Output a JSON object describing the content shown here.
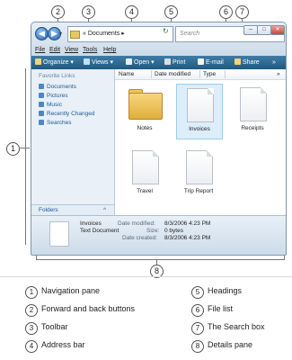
{
  "callouts": [
    "1",
    "2",
    "3",
    "4",
    "5",
    "6",
    "7",
    "8"
  ],
  "address_bar": {
    "prefix": "«",
    "path": "Documents",
    "separator": "▸",
    "dropdown": "▾",
    "refresh": "↻"
  },
  "search": {
    "placeholder": "Search"
  },
  "window_controls": {
    "minimize": "─",
    "maximize": "□",
    "close": "✕"
  },
  "nav_buttons": {
    "back": "◀",
    "forward": "▶",
    "history": "▾"
  },
  "menu": [
    "File",
    "Edit",
    "View",
    "Tools",
    "Help"
  ],
  "toolbar": {
    "organize": "Organize ▾",
    "views": "Views ▾",
    "open": "Open ▾",
    "print": "Print",
    "email": "E-mail",
    "share": "Share",
    "more": "»",
    "colors": {
      "bar": "#2b6a92"
    }
  },
  "nav_pane": {
    "header": "Favorite Links",
    "items": [
      "Documents",
      "Pictures",
      "Music",
      "Recently Changed",
      "Searches"
    ],
    "folders_label": "Folders",
    "folders_toggle": "^"
  },
  "headings": {
    "name": "Name",
    "date_modified": "Date modified",
    "type": "Type",
    "more": "»"
  },
  "files": [
    {
      "name": "Notes",
      "kind": "folder"
    },
    {
      "name": "Invoices",
      "kind": "document",
      "selected": true
    },
    {
      "name": "Receipts",
      "kind": "document"
    },
    {
      "name": "Travel",
      "kind": "document"
    },
    {
      "name": "Trip Report",
      "kind": "document"
    }
  ],
  "details": {
    "name": "Invoices",
    "type": "Text Document",
    "modified_label": "Date modified:",
    "modified_value": "8/3/2006 4:23 PM",
    "size_label": "Size:",
    "size_value": "0 bytes",
    "created_label": "Date created:",
    "created_value": "8/3/2006 4:23 PM"
  },
  "legend": [
    {
      "num": "1",
      "label": "Navigation pane"
    },
    {
      "num": "2",
      "label": "Forward and back buttons"
    },
    {
      "num": "3",
      "label": "Toolbar"
    },
    {
      "num": "4",
      "label": "Address bar"
    },
    {
      "num": "5",
      "label": "Headings"
    },
    {
      "num": "6",
      "label": "File list"
    },
    {
      "num": "7",
      "label": "The Search box"
    },
    {
      "num": "8",
      "label": "Details pane"
    }
  ]
}
